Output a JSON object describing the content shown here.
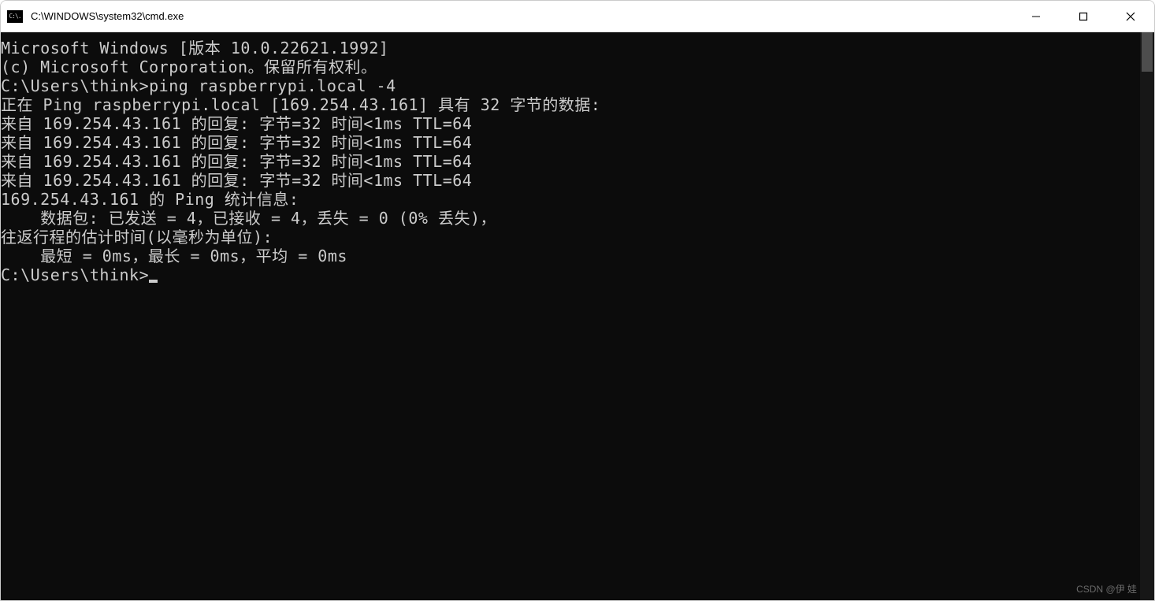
{
  "titlebar": {
    "icon_label": "C:\\.",
    "title": "C:\\WINDOWS\\system32\\cmd.exe"
  },
  "terminal": {
    "lines": {
      "l0": "Microsoft Windows [版本 10.0.22621.1992]",
      "l1": "(c) Microsoft Corporation。保留所有权利。",
      "l2": "",
      "l3": "C:\\Users\\think>ping raspberrypi.local -4",
      "l4": "",
      "l5": "正在 Ping raspberrypi.local [169.254.43.161] 具有 32 字节的数据:",
      "l6": "来自 169.254.43.161 的回复: 字节=32 时间<1ms TTL=64",
      "l7": "来自 169.254.43.161 的回复: 字节=32 时间<1ms TTL=64",
      "l8": "来自 169.254.43.161 的回复: 字节=32 时间<1ms TTL=64",
      "l9": "来自 169.254.43.161 的回复: 字节=32 时间<1ms TTL=64",
      "l10": "",
      "l11": "169.254.43.161 的 Ping 统计信息:",
      "l12": "    数据包: 已发送 = 4，已接收 = 4，丢失 = 0 (0% 丢失)，",
      "l13": "往返行程的估计时间(以毫秒为单位):",
      "l14": "    最短 = 0ms，最长 = 0ms，平均 = 0ms",
      "l15": "",
      "l16": "C:\\Users\\think>"
    }
  },
  "watermark": "CSDN @伊 娃"
}
